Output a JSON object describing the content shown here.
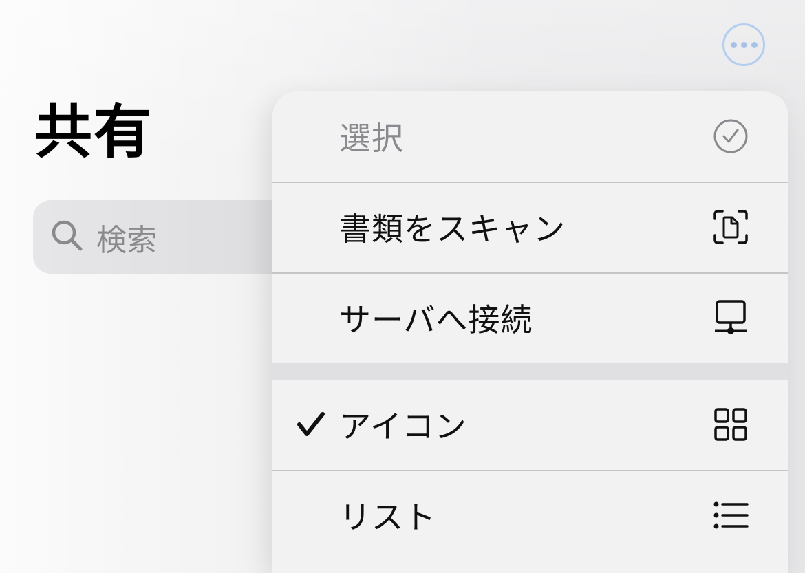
{
  "header": {
    "more_button_icon": "ellipsis-circle-icon",
    "title": "共有"
  },
  "search": {
    "icon": "magnifying-glass-icon",
    "placeholder": "検索"
  },
  "menu": {
    "items": [
      {
        "label": "選択",
        "icon": "checkmark-circle-icon",
        "disabled": true
      },
      {
        "label": "書類をスキャン",
        "icon": "document-scan-icon"
      },
      {
        "label": "サーバへ接続",
        "icon": "server-network-icon"
      },
      {
        "label": "アイコン",
        "icon": "grid-icon",
        "checked": true
      },
      {
        "label": "リスト",
        "icon": "list-icon"
      }
    ]
  },
  "colors": {
    "accent_light": "#b3cef0",
    "text_primary": "#111111",
    "text_secondary": "#8a8a8e",
    "menu_background": "#f2f2f3"
  }
}
